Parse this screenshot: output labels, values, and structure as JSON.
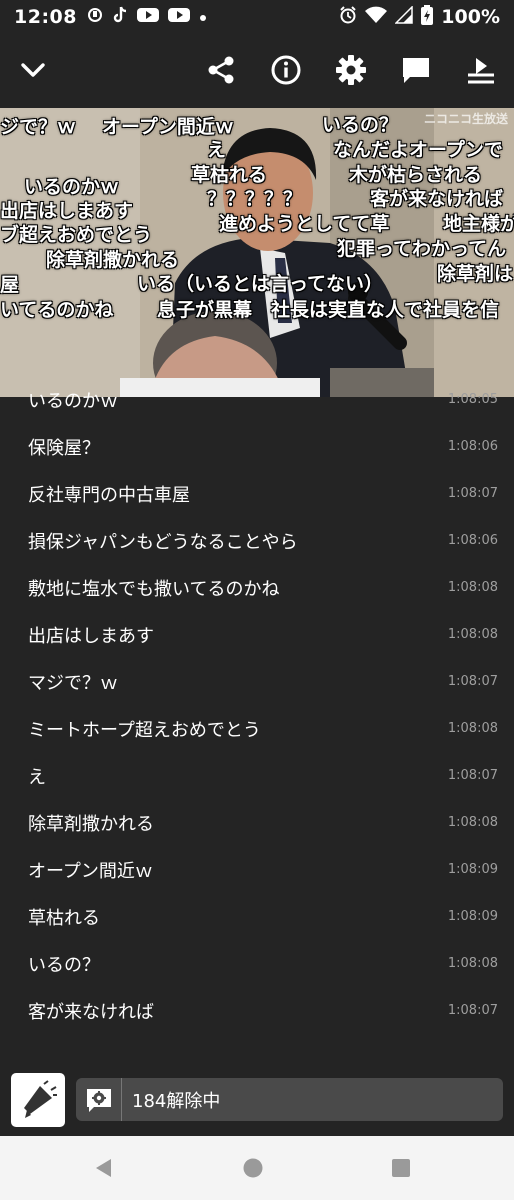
{
  "status": {
    "time": "12:08",
    "battery": "100%"
  },
  "overlay": {
    "logo": "ニコニコ生放送",
    "comments": [
      "ジで？ｗ",
      "オープン間近ｗ",
      "いるの？",
      "え",
      "なんだよオープンで",
      "草枯れる",
      "木が枯らされる",
      "いるのかｗ",
      "？？？？？",
      "客が来なければ",
      "出店はしまあす",
      "進めようとしてて草",
      "地主様が",
      "ブ超えおめでとう",
      "犯罪ってわかってん",
      "除草剤撒かれる",
      "除草剤は",
      "屋",
      "いる（いるとは言ってない）",
      "いてるのかね",
      "息子が黒幕　社長は実直な人で社員を信"
    ]
  },
  "comment_list": [
    {
      "text": "いるのかｗ",
      "time": "1:08:05"
    },
    {
      "text": "保険屋？",
      "time": "1:08:06"
    },
    {
      "text": "反社専門の中古車屋",
      "time": "1:08:07"
    },
    {
      "text": "損保ジャパンもどうなることやら",
      "time": "1:08:06"
    },
    {
      "text": "敷地に塩水でも撒いてるのかね",
      "time": "1:08:08"
    },
    {
      "text": "出店はしまあす",
      "time": "1:08:08"
    },
    {
      "text": "マジで？ｗ",
      "time": "1:08:07"
    },
    {
      "text": "ミートホープ超えおめでとう",
      "time": "1:08:08"
    },
    {
      "text": "え",
      "time": "1:08:07"
    },
    {
      "text": "除草剤撒かれる",
      "time": "1:08:08"
    },
    {
      "text": "オープン間近ｗ",
      "time": "1:08:09"
    },
    {
      "text": "草枯れる",
      "time": "1:08:09"
    },
    {
      "text": "いるの？",
      "time": "1:08:08"
    },
    {
      "text": "客が来なければ",
      "time": "1:08:07"
    }
  ],
  "input": {
    "status_text": "184解除中"
  },
  "colors": {
    "background": "#242424",
    "time_text": "#9e9e9e",
    "input_bg": "#4a4a4a",
    "nav_bg": "#f4f4f4"
  }
}
